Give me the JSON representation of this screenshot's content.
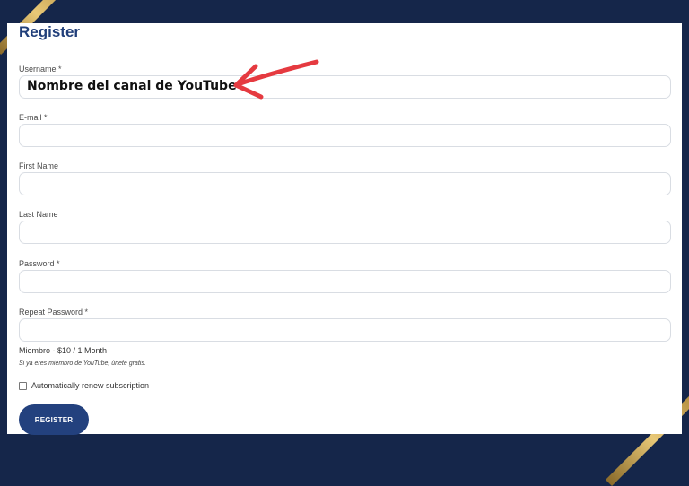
{
  "form": {
    "title": "Register",
    "username": {
      "label": "Username *",
      "value": "Nombre del canal de YouTube"
    },
    "email": {
      "label": "E-mail *"
    },
    "first_name": {
      "label": "First Name"
    },
    "last_name": {
      "label": "Last Name"
    },
    "password": {
      "label": "Password *"
    },
    "repeat_password": {
      "label": "Repeat Password *"
    },
    "plan": {
      "text": "Miembro - $10 / 1 Month",
      "note": "Si ya eres miembro de YouTube, únete gratis."
    },
    "renew": {
      "label": "Automatically renew subscription",
      "checked": false
    },
    "submit_label": "REGISTER"
  },
  "annotation": {
    "arrow_color": "#e53a40"
  },
  "colors": {
    "background": "#15264a",
    "accent": "#23417e",
    "gold": "#d7b25e"
  }
}
